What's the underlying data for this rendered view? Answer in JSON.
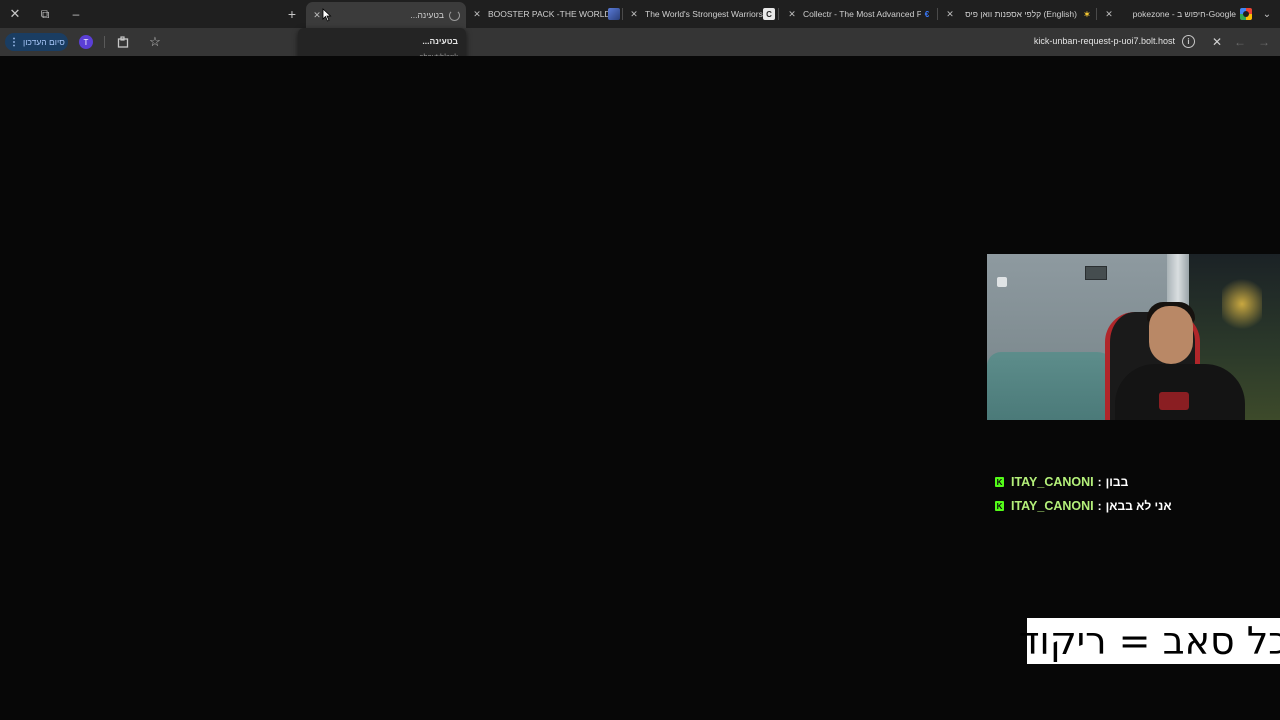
{
  "window": {
    "close_glyph": "✕",
    "restore_glyph": "⧉",
    "minimize_glyph": "–",
    "newtab_glyph": "+",
    "tabmenu_glyph": "⌄"
  },
  "tabs": [
    {
      "title": "...בטעינה",
      "favicon": "spinner-icon",
      "active": true
    },
    {
      "title": "BOOSTER PACK -THE WORLD'S",
      "favicon": "site-icon"
    },
    {
      "title": "The World's Strongest Warriors",
      "favicon": "c-icon"
    },
    {
      "title": "Collectr - The Most Advanced P",
      "favicon": "collectr-icon"
    },
    {
      "title": "קלפי אספנות וואן פיס (English)",
      "favicon": "k-icon"
    },
    {
      "title": "pokezone - חיפוש ב-Google",
      "favicon": "google-icon"
    }
  ],
  "tab_close_glyph": "✕",
  "toolbar": {
    "update_label": "סיום העדכון",
    "profile_initial": "T",
    "url": "kick-unban-request-p-uoi7.bolt.host"
  },
  "hovercard": {
    "title": "...בטעינה",
    "url": "about:blank"
  },
  "chat": {
    "messages": [
      {
        "user": "ITAY_CANONI",
        "text": "בבון"
      },
      {
        "user": "ITAY_CANONI",
        "text": "אני לא בבאן"
      }
    ]
  },
  "banner": {
    "text": "כל סאב = ריקוד"
  },
  "colors": {
    "accent_kick": "#53fc18",
    "username": "#b4f07a",
    "update_button": "#1a3d62"
  }
}
